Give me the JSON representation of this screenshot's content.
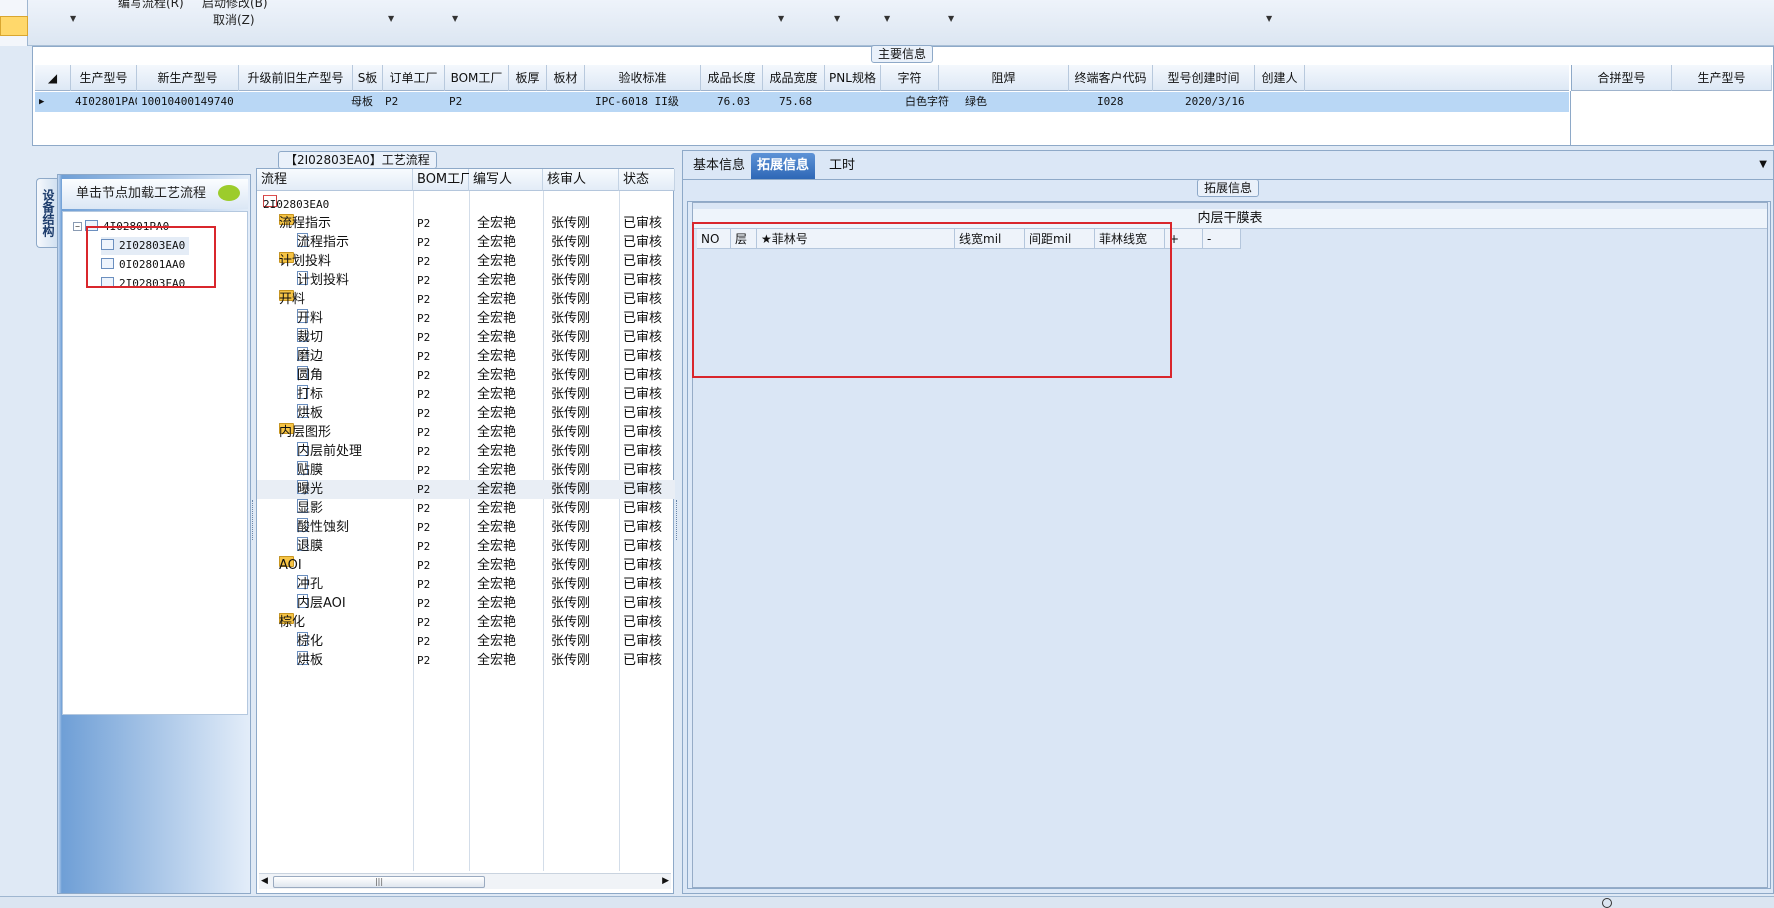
{
  "ribbon": {
    "btn_edit_flow": "编写流程(R)",
    "btn_start_modify": "启动修改(B)",
    "btn_cancel": "取消(Z)"
  },
  "main_info": {
    "title": "主要信息",
    "columns": [
      "生产型号",
      "新生产型号",
      "升级前旧生产型号",
      "S板",
      "订单工厂",
      "BOM工厂",
      "板厚",
      "板材",
      "验收标准",
      "成品长度",
      "成品宽度",
      "PNL规格",
      "字符",
      "阻焊",
      "终端客户代码",
      "型号创建时间",
      "创建人"
    ],
    "row": [
      "4I02801PA0",
      "10010400149740",
      "",
      "母板",
      "P2",
      "P2",
      "",
      "",
      "IPC-6018 II级",
      "76.03",
      "75.68",
      "",
      "白色字符",
      "绿色",
      "I028",
      "2020/3/16",
      ""
    ],
    "side_columns": [
      "合拼型号",
      "生产型号"
    ]
  },
  "device_structure": {
    "vtab": "设备结构",
    "head": "单击节点加载工艺流程",
    "root": "4I02801PA0",
    "children": [
      "2I02803EA0",
      "0I02801AA0",
      "2I02803FA0"
    ]
  },
  "process_flow": {
    "title": "【2I02803EA0】工艺流程",
    "columns": [
      "流程",
      "BOM工厂",
      "编写人",
      "核审人",
      "状态"
    ],
    "root": "2I02803EA0",
    "rows": [
      {
        "name": "流程指示",
        "type": "folder",
        "bom": "P2",
        "writer": "全宏艳",
        "reviewer": "张传刚",
        "status": "已审核"
      },
      {
        "name": "流程指示",
        "type": "doc",
        "bom": "P2",
        "writer": "全宏艳",
        "reviewer": "张传刚",
        "status": "已审核"
      },
      {
        "name": "计划投料",
        "type": "folder",
        "bom": "P2",
        "writer": "全宏艳",
        "reviewer": "张传刚",
        "status": "已审核"
      },
      {
        "name": "计划投料",
        "type": "doc",
        "bom": "P2",
        "writer": "全宏艳",
        "reviewer": "张传刚",
        "status": "已审核"
      },
      {
        "name": "开料",
        "type": "folder",
        "bom": "P2",
        "writer": "全宏艳",
        "reviewer": "张传刚",
        "status": "已审核"
      },
      {
        "name": "开料",
        "type": "doc",
        "bom": "P2",
        "writer": "全宏艳",
        "reviewer": "张传刚",
        "status": "已审核"
      },
      {
        "name": "裁切",
        "type": "doc",
        "bom": "P2",
        "writer": "全宏艳",
        "reviewer": "张传刚",
        "status": "已审核"
      },
      {
        "name": "磨边",
        "type": "doc",
        "bom": "P2",
        "writer": "全宏艳",
        "reviewer": "张传刚",
        "status": "已审核"
      },
      {
        "name": "圆角",
        "type": "doc",
        "bom": "P2",
        "writer": "全宏艳",
        "reviewer": "张传刚",
        "status": "已审核"
      },
      {
        "name": "打标",
        "type": "doc",
        "bom": "P2",
        "writer": "全宏艳",
        "reviewer": "张传刚",
        "status": "已审核"
      },
      {
        "name": "烘板",
        "type": "doc",
        "bom": "P2",
        "writer": "全宏艳",
        "reviewer": "张传刚",
        "status": "已审核"
      },
      {
        "name": "内层图形",
        "type": "folder",
        "bom": "P2",
        "writer": "全宏艳",
        "reviewer": "张传刚",
        "status": "已审核"
      },
      {
        "name": "内层前处理",
        "type": "doc",
        "bom": "P2",
        "writer": "全宏艳",
        "reviewer": "张传刚",
        "status": "已审核"
      },
      {
        "name": "贴膜",
        "type": "doc",
        "bom": "P2",
        "writer": "全宏艳",
        "reviewer": "张传刚",
        "status": "已审核"
      },
      {
        "name": "曝光",
        "type": "doc",
        "bom": "P2",
        "writer": "全宏艳",
        "reviewer": "张传刚",
        "status": "已审核"
      },
      {
        "name": "显影",
        "type": "doc",
        "bom": "P2",
        "writer": "全宏艳",
        "reviewer": "张传刚",
        "status": "已审核"
      },
      {
        "name": "酸性蚀刻",
        "type": "doc",
        "bom": "P2",
        "writer": "全宏艳",
        "reviewer": "张传刚",
        "status": "已审核"
      },
      {
        "name": "退膜",
        "type": "doc",
        "bom": "P2",
        "writer": "全宏艳",
        "reviewer": "张传刚",
        "status": "已审核"
      },
      {
        "name": "AOI",
        "type": "folder",
        "bom": "P2",
        "writer": "全宏艳",
        "reviewer": "张传刚",
        "status": "已审核"
      },
      {
        "name": "冲孔",
        "type": "doc",
        "bom": "P2",
        "writer": "全宏艳",
        "reviewer": "张传刚",
        "status": "已审核"
      },
      {
        "name": "内层AOI",
        "type": "doc",
        "bom": "P2",
        "writer": "全宏艳",
        "reviewer": "张传刚",
        "status": "已审核"
      },
      {
        "name": "棕化",
        "type": "folder",
        "bom": "P2",
        "writer": "全宏艳",
        "reviewer": "张传刚",
        "status": "已审核"
      },
      {
        "name": "棕化",
        "type": "doc",
        "bom": "P2",
        "writer": "全宏艳",
        "reviewer": "张传刚",
        "status": "已审核"
      },
      {
        "name": "烘板",
        "type": "doc",
        "bom": "P2",
        "writer": "全宏艳",
        "reviewer": "张传刚",
        "status": "已审核"
      }
    ]
  },
  "right_tabs": [
    "基本信息",
    "拓展信息",
    "工时"
  ],
  "active_tab": "拓展信息",
  "extended": {
    "group_title": "拓展信息",
    "table_title": "内层干膜表",
    "columns": [
      "NO",
      "层",
      "★菲林号",
      "线宽mil",
      "间距mil",
      "菲林线宽",
      "+",
      "-"
    ]
  },
  "colors": {
    "selection_row": "#b9d7f5",
    "highlight_box": "#d9262c",
    "active_tab": "#2e67b6"
  }
}
